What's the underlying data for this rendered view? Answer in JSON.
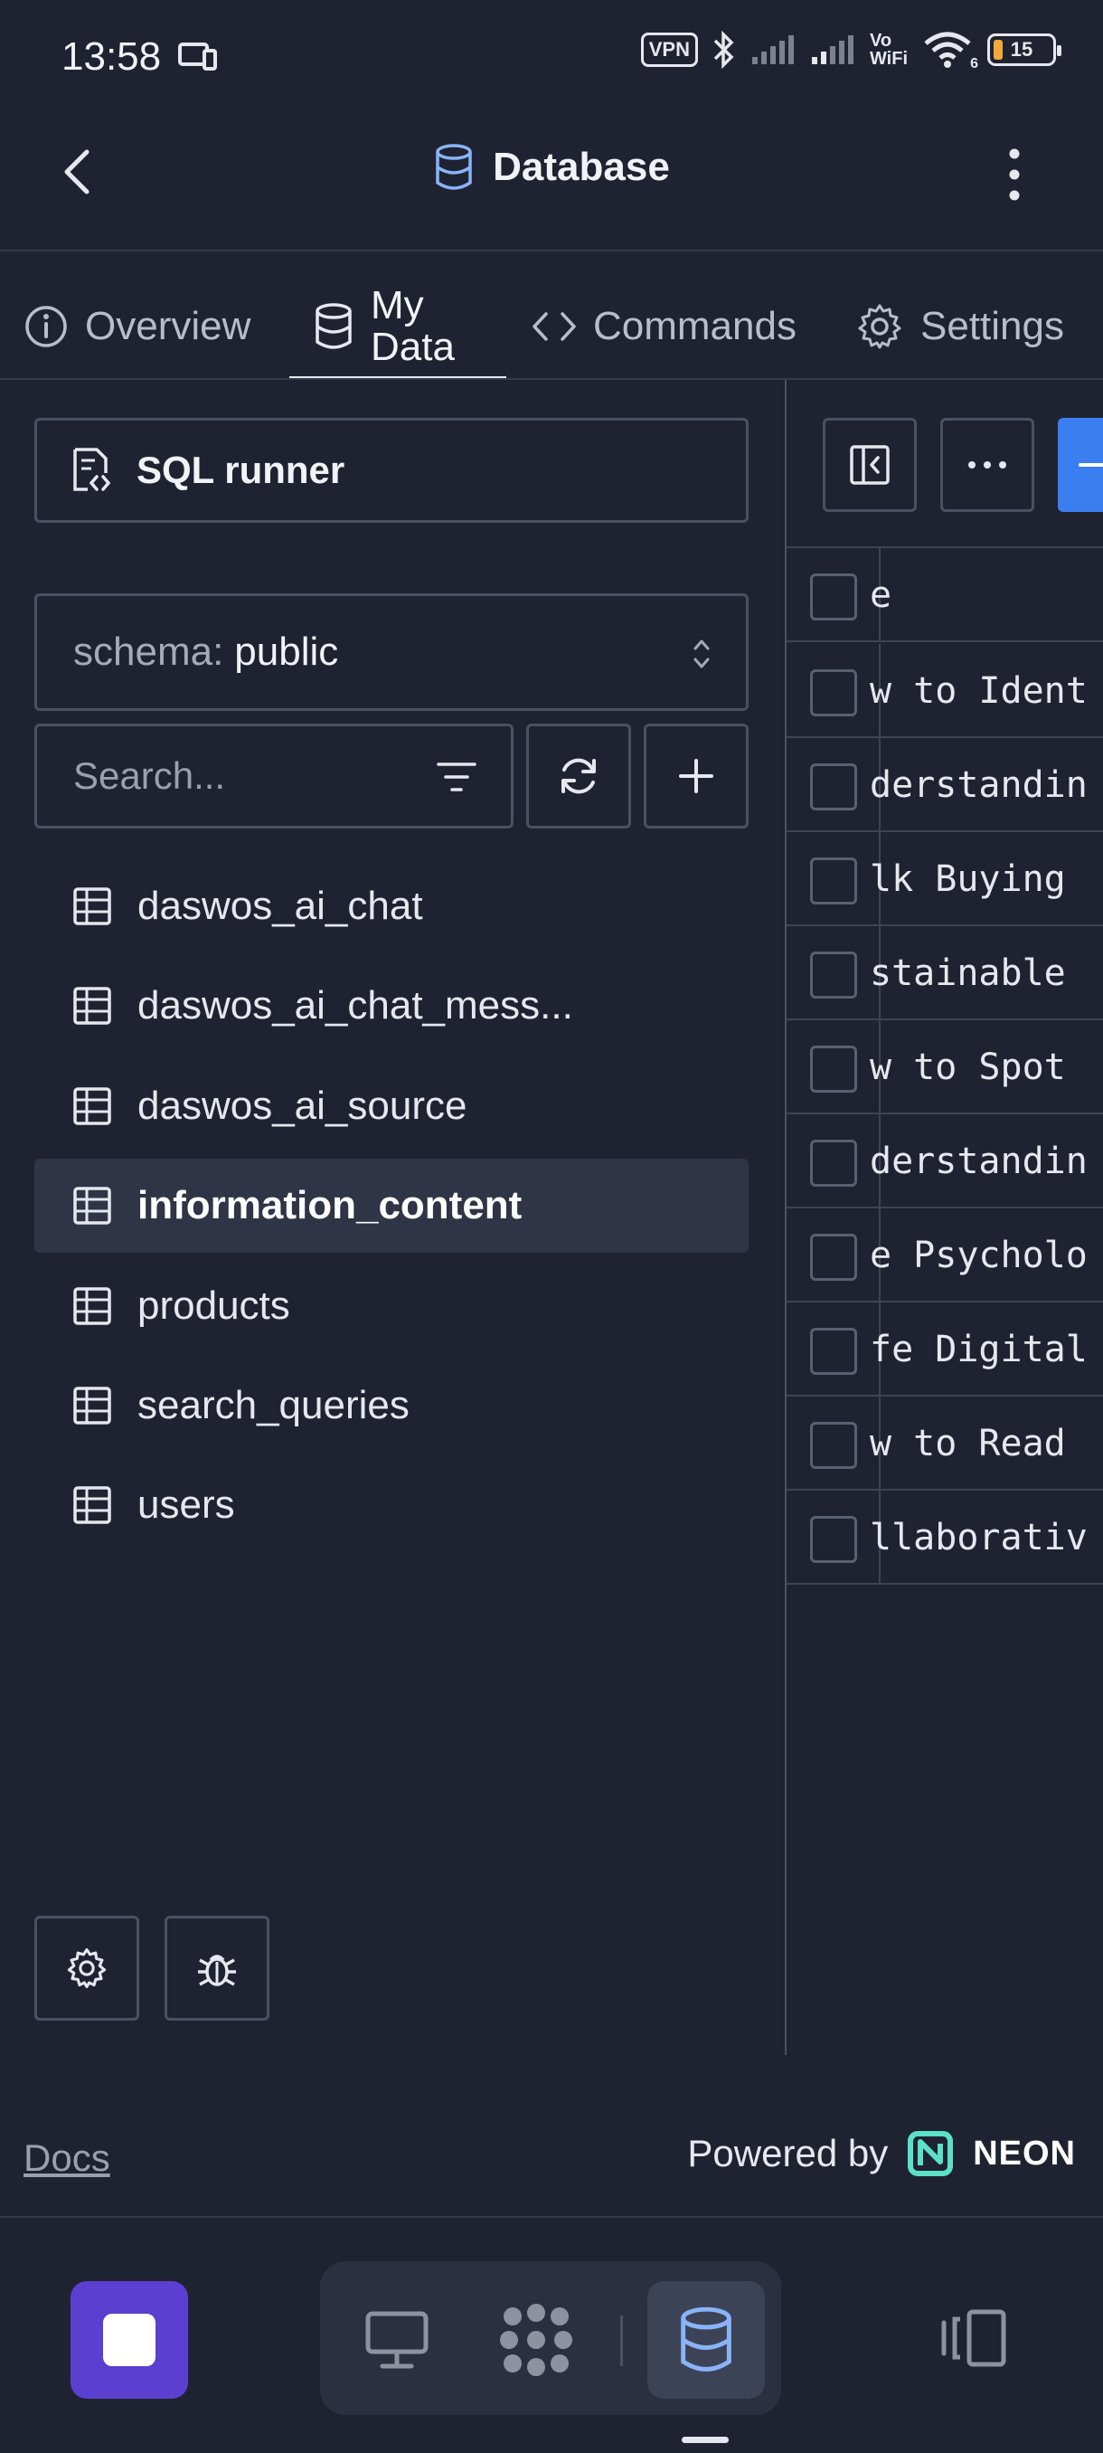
{
  "status_bar": {
    "time": "13:58",
    "vpn": "VPN",
    "vowifi_top": "Vo",
    "vowifi_bottom": "WiFi",
    "wifi_sub": "6",
    "battery": "15"
  },
  "header": {
    "title": "Database"
  },
  "tabs": [
    {
      "label": "Overview",
      "icon": "info-icon"
    },
    {
      "label_line1": "My",
      "label_line2": "Data",
      "icon": "database-icon",
      "active": true
    },
    {
      "label": "Commands",
      "icon": "code-icon"
    },
    {
      "label": "Settings",
      "icon": "gear-icon"
    }
  ],
  "sidebar": {
    "sql_runner_label": "SQL runner",
    "schema_label": "schema:",
    "schema_value": "public",
    "search_placeholder": "Search...",
    "tables": [
      {
        "name": "daswos_ai_chat"
      },
      {
        "name": "daswos_ai_chat_mess..."
      },
      {
        "name": "daswos_ai_source"
      },
      {
        "name": "information_content",
        "selected": true
      },
      {
        "name": "products"
      },
      {
        "name": "search_queries"
      },
      {
        "name": "users"
      }
    ]
  },
  "data_grid": {
    "header_cell": "e",
    "rows": [
      "w to Ident",
      "derstandin",
      "lk Buying",
      "stainable",
      "w to Spot",
      "derstandin",
      "e Psycholo",
      "fe Digital",
      "w to Read",
      "llaborativ"
    ]
  },
  "footer": {
    "docs_label": "Docs",
    "powered_by": "Powered by",
    "brand": "NEON",
    "brand_color": "#5ce0c9"
  },
  "colors": {
    "background": "#1f2331",
    "accent_primary": "#3b7ef0",
    "stop_button": "#5b3fd0"
  }
}
